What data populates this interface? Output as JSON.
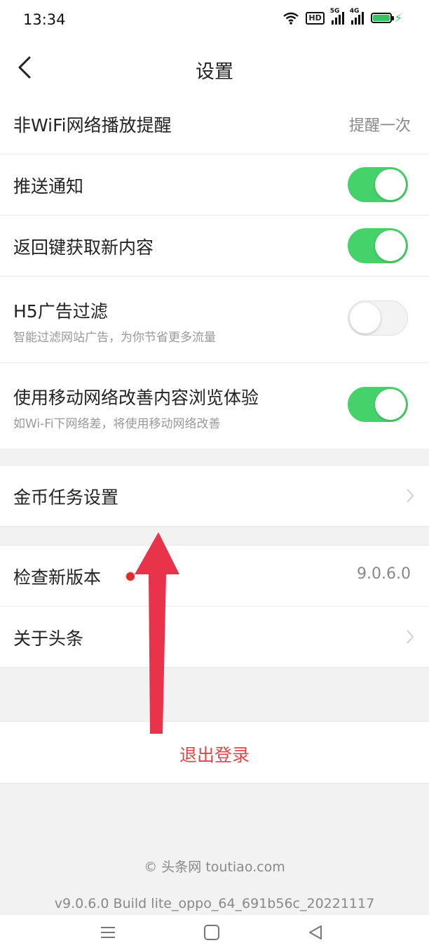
{
  "status_bar": {
    "time": "13:34",
    "hd_label": "HD",
    "sig1_tag": "5G",
    "sig2_tag": "4G",
    "battery_color": "#35c35f"
  },
  "header": {
    "title": "设置"
  },
  "group1": {
    "row1": {
      "label": "非WiFi网络播放提醒",
      "value": "提醒一次"
    },
    "row2": {
      "label": "推送通知",
      "toggle": "on"
    },
    "row3": {
      "label": "返回键获取新内容",
      "toggle": "on"
    },
    "row4": {
      "label": "H5广告过滤",
      "sub": "智能过滤网站广告，为你节省更多流量",
      "toggle": "off"
    },
    "row5": {
      "label": "使用移动网络改善内容浏览体验",
      "sub": "如Wi-Fi下网络差，将使用移动网络改善",
      "toggle": "on"
    }
  },
  "group2": {
    "row1": {
      "label": "金币任务设置"
    }
  },
  "group3": {
    "row1": {
      "label": "检查新版本",
      "value": "9.0.6.0"
    },
    "row2": {
      "label": "关于头条"
    }
  },
  "logout": {
    "label": "退出登录"
  },
  "footer": {
    "copyright": "© 头条网 toutiao.com",
    "build": "v9.0.6.0 Build lite_oppo_64_691b56c_20221117"
  },
  "colors": {
    "toggle_on": "#46d26a",
    "logout_text": "#e04545",
    "annotation_arrow": "#e8334a"
  }
}
